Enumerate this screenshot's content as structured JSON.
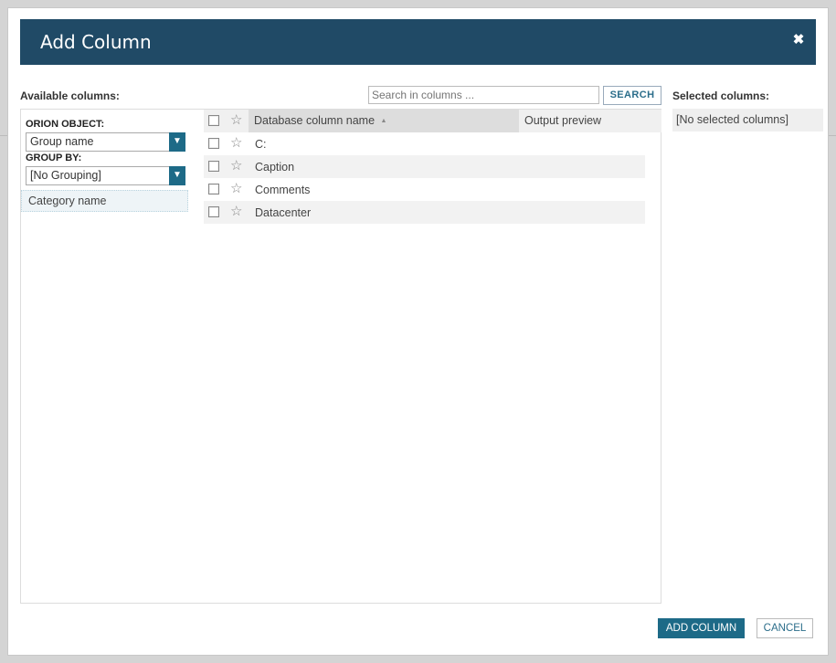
{
  "dialog": {
    "title": "Add Column",
    "close_glyph": "✖"
  },
  "available": {
    "label": "Available columns:",
    "search_placeholder": "Search in columns ...",
    "search_button": "SEARCH",
    "orion_object_label": "ORION OBJECT:",
    "orion_object_value": "Group name",
    "group_by_label": "GROUP BY:",
    "group_by_value": "[No Grouping]",
    "category": "Category name",
    "headers": {
      "name": "Database column name",
      "sort_glyph": "▲",
      "preview": "Output preview"
    },
    "rows": [
      {
        "name": "C:"
      },
      {
        "name": "Caption"
      },
      {
        "name": "Comments"
      },
      {
        "name": "Datacenter"
      }
    ]
  },
  "selected": {
    "label": "Selected columns:",
    "empty_text": "[No selected columns]"
  },
  "footer": {
    "add_label": "ADD COLUMN",
    "cancel_label": "CANCEL"
  },
  "icons": {
    "star": "star-icon",
    "checkbox": "checkbox-icon",
    "dropdown": "chevron-down-icon",
    "close": "close-icon"
  },
  "colors": {
    "header_bg": "#204a66",
    "accent": "#1d6a87"
  }
}
